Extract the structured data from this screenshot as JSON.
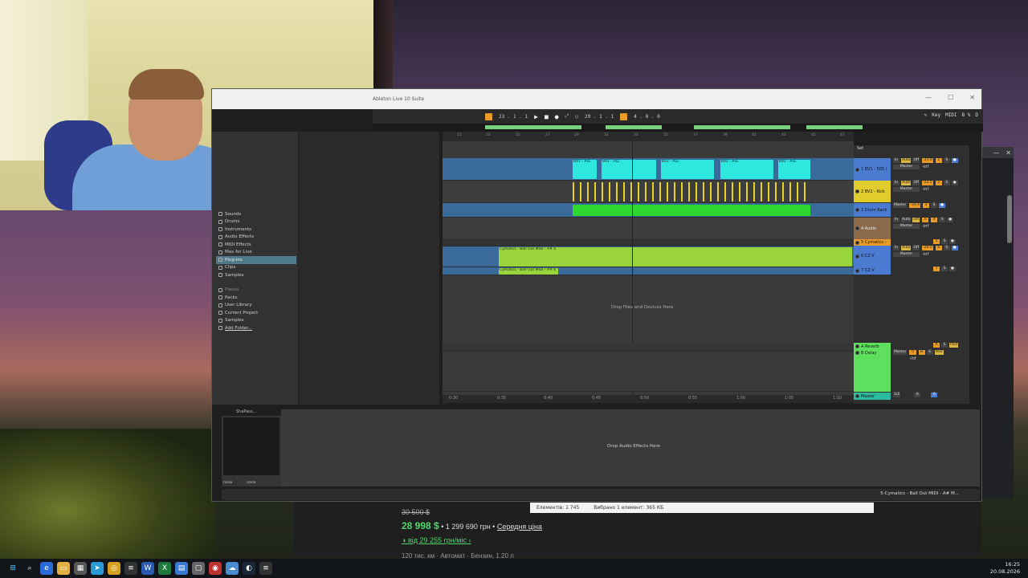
{
  "ableton": {
    "window_title": "Ableton Live 10 Suite",
    "transport": {
      "position": "23 .  1 .  1",
      "loop_start": "29 .  1 .  1",
      "loop_length": "4 .  0 .  0",
      "key_label": "Key",
      "midi_label": "MIDI",
      "cpu": "8 %",
      "d_label": "D"
    },
    "browser": {
      "categories": [
        "Sounds",
        "Drums",
        "Instruments",
        "Audio Effects",
        "MIDI Effects",
        "Max for Live",
        "Plug-ins",
        "Clips",
        "Samples"
      ],
      "selected_category": "Plug-ins",
      "places": [
        "Places",
        "Packs",
        "User Library",
        "Current Project",
        "Samples",
        "Add Folder..."
      ]
    },
    "ruler_bars": [
      "21",
      "23",
      "25",
      "27",
      "29",
      "31",
      "33",
      "35",
      "37",
      "39",
      "41",
      "43",
      "45",
      "47"
    ],
    "time_ruler": [
      "0:30",
      "0:35",
      "0:40",
      "0:45",
      "0:50",
      "0:55",
      "1:00",
      "1:05",
      "1:10"
    ],
    "arrangement": {
      "drop_text": "Drop Files and Devices Here",
      "clip_labels": {
        "bv_a": "BV1 - ALL",
        "bv_b": "BV2 - ALL",
        "cymatics": "Cymatics - Ball Out MIDI - A# 6"
      }
    },
    "mixer": {
      "set_label": "Set",
      "tracks": [
        {
          "name": "1 BV1 - 505 (",
          "color": "#4a7bd0",
          "volume": "-21.0",
          "peak": "-inf",
          "route": "Master",
          "io": "In",
          "monitor": "Auto",
          "off": "Off"
        },
        {
          "name": "2 BV2 - Kick",
          "color": "#e0cc2c",
          "volume": "-22.5",
          "peak": "-inf",
          "route": "Master",
          "io": "In",
          "monitor": "Auto",
          "off": "Off"
        },
        {
          "name": "3 Drum Rack",
          "color": "#4a7bd0",
          "volume": "-19.4",
          "peak": "",
          "route": "Master"
        },
        {
          "name": "4 Audio",
          "color": "#8a6a4a",
          "volume": "0",
          "peak": "-inf",
          "route": "Master",
          "io": "In",
          "monitor": "Auto",
          "off": "Off"
        },
        {
          "name": "5 Cymatics -",
          "color": "#e89a26",
          "volume": "",
          "peak": "",
          "route": ""
        },
        {
          "name": "6 CZ V",
          "color": "#4a7bd0",
          "volume": "-24.0",
          "peak": "-inf",
          "route": "Master",
          "io": "In",
          "monitor": "Auto",
          "off": "Off"
        },
        {
          "name": "7 CZ V",
          "color": "#4a7bd0",
          "volume": "",
          "peak": "",
          "route": ""
        }
      ],
      "returns": [
        {
          "name": "A Reverb",
          "color": "#5ee05e"
        },
        {
          "name": "B Delay",
          "color": "#5ee05e",
          "route": "Master",
          "volume": "0",
          "peak": "-inf"
        }
      ],
      "master": {
        "name": "Master",
        "cue": "1/2",
        "volume": "0",
        "peak": "0"
      }
    },
    "detail": {
      "device_title": "ShaPass...",
      "device_opt1": "none",
      "device_opt2": "none",
      "drop_text": "Drop Audio Effects Here"
    },
    "status_right": "5-Cymatics - Ball Out MIDI - A# M..."
  },
  "web": {
    "old_price": "30 500 $",
    "price": "28 998 $",
    "price_uah": "• 1 299 690 грн •",
    "avg_price_link": "Середня ціна",
    "installment": "від 29 255 грн/міс",
    "truncated_row": "120 тис. км  ·  Автомат  ·  Бензин, 1.20 л"
  },
  "explorer_status": {
    "items": "Елементів: 1 745",
    "selected": "Вибрано 1 елемент: 365 КБ"
  },
  "taskbar": {
    "time": "16:25",
    "date": "20.08.2026"
  },
  "colors": {
    "accent_orange": "#e89a26",
    "clip_cyan": "#2ee8e0",
    "clip_yellow": "#e6d21e",
    "clip_green": "#2ed82e",
    "clip_lime": "#9ad43c",
    "track_blue": "#3a6a9a"
  }
}
